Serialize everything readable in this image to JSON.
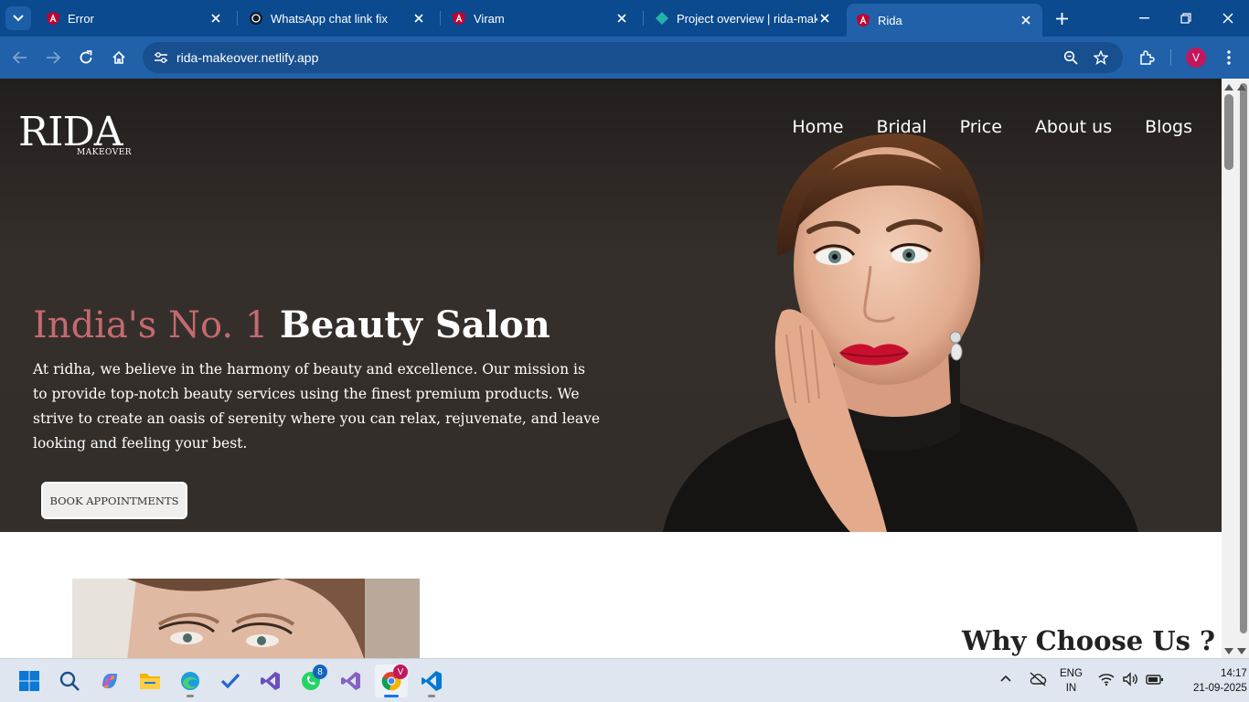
{
  "browser": {
    "tabs": [
      {
        "title": "Error",
        "active": false
      },
      {
        "title": "WhatsApp chat link fix",
        "active": false
      },
      {
        "title": "Viram",
        "active": false
      },
      {
        "title": "Project overview | rida-make",
        "active": false
      },
      {
        "title": "Rida",
        "active": true
      }
    ],
    "url": "rida-makeover.netlify.app",
    "profile_initial": "V"
  },
  "site": {
    "logo_main": "RIDA",
    "logo_sub": "MAKEOVER",
    "nav": [
      "Home",
      "Bridal",
      "Price",
      "About us",
      "Blogs"
    ],
    "hero": {
      "title_accent": "India's No. 1",
      "title_rest": "Beauty Salon",
      "body": "At ridha, we believe in the harmony of beauty and excellence. Our mission is to provide top-notch beauty services using the finest premium products. We strive to create an oasis of serenity where you can relax, rejuvenate, and leave looking and feeling your best.",
      "cta": "BOOK APPOINTMENTS"
    },
    "why_title": "Why Choose Us ?"
  },
  "taskbar": {
    "whatsapp_badge": "8",
    "chrome_badge": "V",
    "lang_1": "ENG",
    "lang_2": "IN",
    "time": "14:17",
    "date": "21-09-2025"
  },
  "colors": {
    "accent": "#c46a6f",
    "browser_frame": "#0b4a8f",
    "toolbar": "#2061aa"
  }
}
